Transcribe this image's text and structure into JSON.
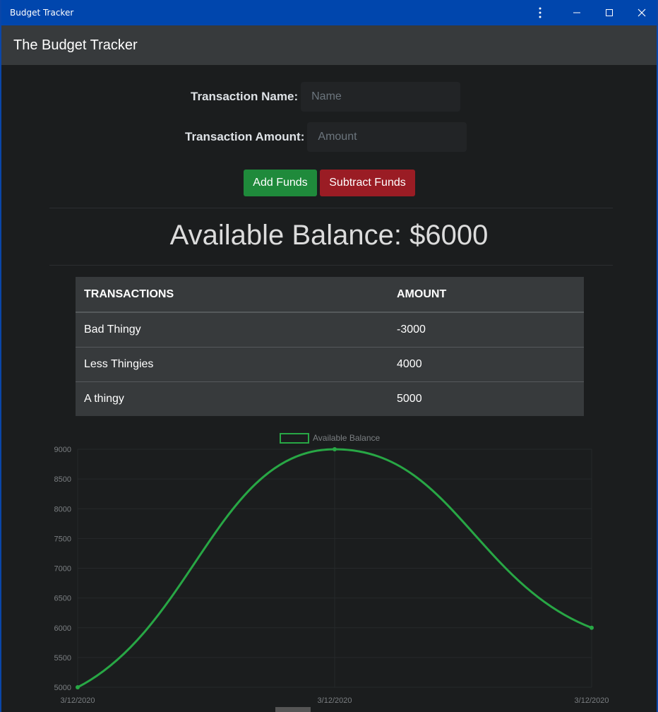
{
  "window": {
    "title": "Budget Tracker",
    "accent": "#0046ad"
  },
  "navbar": {
    "brand": "The Budget Tracker"
  },
  "form": {
    "name_label": "Transaction Name:",
    "name_placeholder": "Name",
    "name_value": "",
    "amount_label": "Transaction Amount:",
    "amount_placeholder": "Amount",
    "amount_value": "",
    "add_label": "Add Funds",
    "subtract_label": "Subtract Funds"
  },
  "balance": {
    "text": "Available Balance: $6000"
  },
  "table": {
    "headers": [
      "TRANSACTIONS",
      "AMOUNT"
    ],
    "rows": [
      {
        "name": "Bad Thingy",
        "amount": "-3000"
      },
      {
        "name": "Less Thingies",
        "amount": "4000"
      },
      {
        "name": "A thingy",
        "amount": "5000"
      }
    ]
  },
  "icons": {
    "more": "more-vertical-icon",
    "minimize": "minimize-icon",
    "maximize": "maximize-icon",
    "close": "close-icon"
  },
  "colors": {
    "add": "#1f8a3b",
    "subtract": "#9a1c24",
    "series": "#28a745"
  },
  "chart_data": {
    "type": "line",
    "legend": [
      "Available Balance"
    ],
    "legend_position": "top",
    "categories": [
      "3/12/2020",
      "3/12/2020",
      "3/12/2020"
    ],
    "series": [
      {
        "name": "Available Balance",
        "values": [
          5000,
          9000,
          6000
        ]
      }
    ],
    "ylim": [
      5000,
      9000
    ],
    "yticks": [
      "9000",
      "8500",
      "8000",
      "7500",
      "7000",
      "6500",
      "6000",
      "5500",
      "5000"
    ],
    "grid": true,
    "title": "",
    "xlabel": "",
    "ylabel": ""
  }
}
